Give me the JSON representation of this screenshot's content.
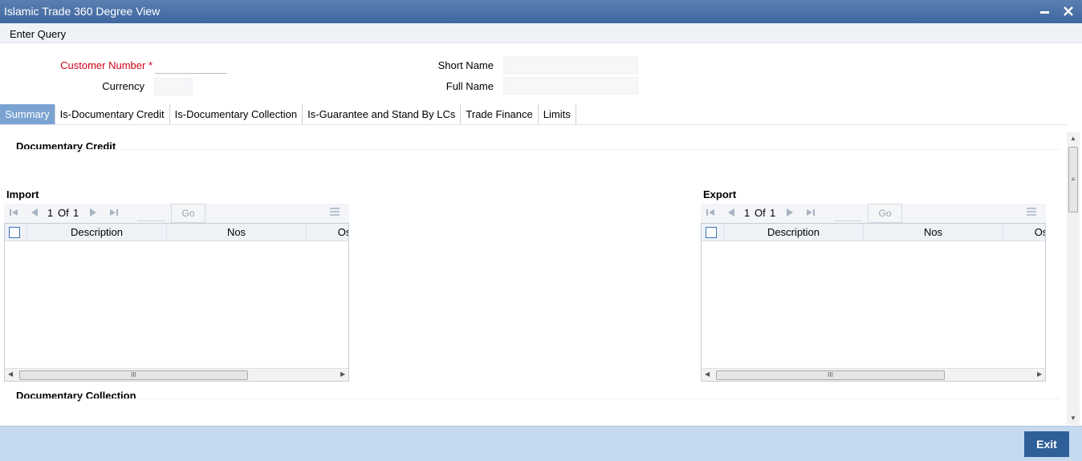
{
  "window": {
    "title": "Islamic Trade 360 Degree View"
  },
  "menu": {
    "enter_query": "Enter Query"
  },
  "header": {
    "customer_number_label": "Customer Number",
    "required_marker": "*",
    "customer_number_value": "",
    "currency_label": "Currency",
    "currency_value": "",
    "short_name_label": "Short Name",
    "short_name_value": "",
    "full_name_label": "Full Name",
    "full_name_value": ""
  },
  "tabs": [
    {
      "label": "Summary",
      "active": true
    },
    {
      "label": "Is-Documentary Credit",
      "active": false
    },
    {
      "label": "Is-Documentary Collection",
      "active": false
    },
    {
      "label": "Is-Guarantee and Stand By LCs",
      "active": false
    },
    {
      "label": "Trade Finance",
      "active": false
    },
    {
      "label": "Limits",
      "active": false
    }
  ],
  "summary": {
    "documentary_credit_title": "Documentary Credit",
    "documentary_collection_title": "Documentary Collection",
    "import": {
      "title": "Import",
      "page_current": "1",
      "page_of": "Of",
      "page_total": "1",
      "go_label": "Go",
      "columns": [
        "Description",
        "Nos",
        "Os"
      ]
    },
    "export": {
      "title": "Export",
      "page_current": "1",
      "page_of": "Of",
      "page_total": "1",
      "go_label": "Go",
      "columns": [
        "Description",
        "Nos",
        "Os"
      ]
    }
  },
  "footer": {
    "exit_label": "Exit"
  },
  "colors": {
    "titlebar": "#4a72a8",
    "active_tab": "#7aa3d2",
    "required": "#d0021b",
    "footer": "#c5d9ef",
    "exit_button": "#2f5f98"
  }
}
